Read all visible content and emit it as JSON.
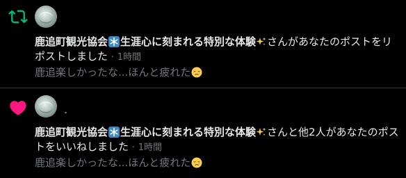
{
  "notifications": [
    {
      "type": "retweet",
      "icon": "retweet-icon",
      "icon_color": "#00ba7c",
      "display_name_part1": "鹿追町観光協会",
      "display_name_part2": "生涯心に刻まれる特別な体験",
      "action_text": "さんがあなたのポストをリポストしました",
      "separator": "·",
      "time": "1時間",
      "quoted_post": "鹿追楽しかったな...ほんと疲れた"
    },
    {
      "type": "like",
      "icon": "heart-icon",
      "icon_color": "#f91880",
      "display_name_part1": "鹿追町観光協会",
      "display_name_part2": "生涯心に刻まれる特別な体験",
      "action_text": "さんと他2人があなたのポストをいいねしました",
      "separator": "·",
      "time": "1時間",
      "quoted_post": "鹿追楽しかったな...ほんと疲れた"
    }
  ],
  "colors": {
    "background": "#000000",
    "primary_text": "#e7e9ea",
    "secondary_text": "#71767b",
    "divider": "#2f3336"
  }
}
